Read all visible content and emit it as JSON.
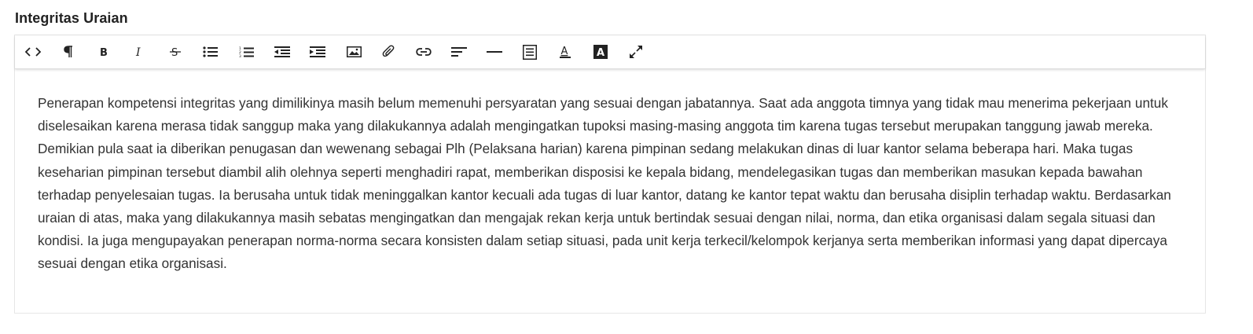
{
  "field": {
    "label": "Integritas Uraian"
  },
  "toolbar": {
    "buttons": [
      {
        "name": "code-view-button",
        "icon": "code-icon"
      },
      {
        "name": "paragraph-button",
        "icon": "pilcrow-icon"
      },
      {
        "name": "bold-button",
        "icon": "bold-icon"
      },
      {
        "name": "italic-button",
        "icon": "italic-icon"
      },
      {
        "name": "strikethrough-button",
        "icon": "strikethrough-icon"
      },
      {
        "name": "unordered-list-button",
        "icon": "bullet-list-icon"
      },
      {
        "name": "ordered-list-button",
        "icon": "numbered-list-icon"
      },
      {
        "name": "outdent-button",
        "icon": "outdent-icon"
      },
      {
        "name": "indent-button",
        "icon": "indent-icon"
      },
      {
        "name": "insert-image-button",
        "icon": "image-icon"
      },
      {
        "name": "insert-file-button",
        "icon": "paperclip-icon"
      },
      {
        "name": "insert-link-button",
        "icon": "link-icon"
      },
      {
        "name": "align-button",
        "icon": "align-left-icon"
      },
      {
        "name": "horizontal-rule-button",
        "icon": "horizontal-rule-icon"
      },
      {
        "name": "format-block-button",
        "icon": "document-lines-icon"
      },
      {
        "name": "font-color-button",
        "icon": "text-color-icon"
      },
      {
        "name": "highlight-color-button",
        "icon": "background-color-icon"
      },
      {
        "name": "fullscreen-button",
        "icon": "expand-icon"
      }
    ]
  },
  "content": {
    "text": "Penerapan kompetensi integritas yang dimilikinya masih belum memenuhi persyaratan yang sesuai dengan jabatannya. Saat ada anggota timnya yang tidak mau menerima pekerjaan untuk diselesaikan karena merasa tidak sanggup maka yang dilakukannya adalah mengingatkan tupoksi masing-masing anggota tim karena tugas tersebut merupakan tanggung jawab mereka. Demikian pula saat ia diberikan penugasan dan wewenang sebagai Plh (Pelaksana harian) karena pimpinan sedang melakukan dinas di luar kantor selama beberapa hari. Maka tugas keseharian pimpinan tersebut diambil alih olehnya seperti menghadiri rapat, memberikan disposisi ke kepala bidang, mendelegasikan tugas dan memberikan masukan kepada bawahan terhadap penyelesaian tugas. Ia berusaha untuk tidak meninggalkan kantor kecuali ada tugas di luar kantor, datang ke kantor tepat waktu dan berusaha disiplin terhadap waktu. Berdasarkan uraian di atas, maka yang dilakukannya masih sebatas mengingatkan dan mengajak rekan kerja untuk bertindak sesuai dengan nilai, norma, dan etika organisasi dalam segala situasi dan kondisi. Ia juga mengupayakan penerapan norma-norma secara konsisten dalam setiap situasi, pada unit kerja terkecil/kelompok kerjanya serta memberikan informasi yang dapat dipercaya sesuai dengan etika organisasi."
  }
}
